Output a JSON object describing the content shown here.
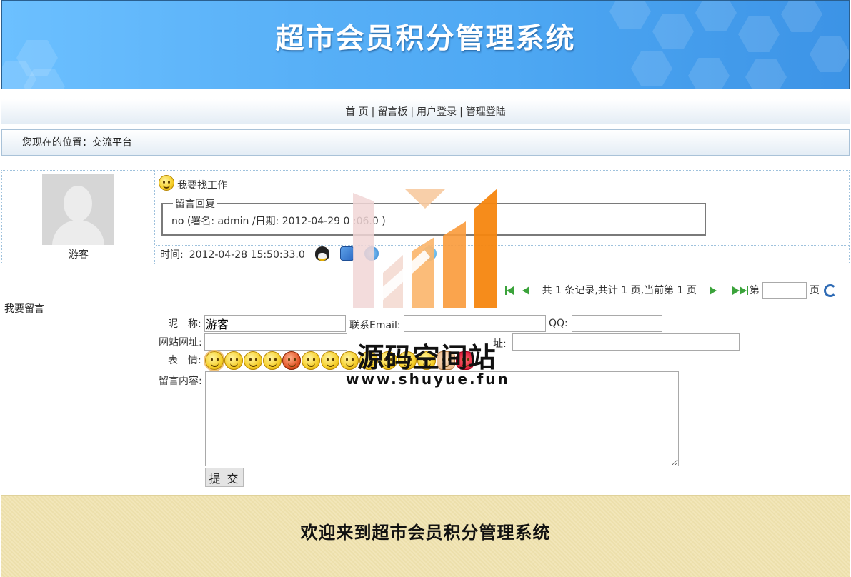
{
  "banner": {
    "title": "超市会员积分管理系统"
  },
  "nav": {
    "items": [
      "首 页",
      "留言板",
      "用户登录",
      "管理登陆"
    ],
    "separator": "|"
  },
  "location": {
    "text": "您现在的位置：交流平台"
  },
  "message": {
    "poster": "游客",
    "title": "我要找工作",
    "reply_legend": "留言回复",
    "reply_text": "no (署名: admin /日期: 2012-04-29 0 :06.0 )",
    "time_label": "时间:",
    "time_value": "2012-04-28 15:50:33.0",
    "icons": [
      "qq-icon",
      "mail-icon",
      "home-icon",
      "globe-icon"
    ]
  },
  "pager": {
    "summary": "共 1 条记录,共计 1 页,当前第 1 页",
    "goto_prefix": "第",
    "goto_suffix": "页",
    "page_input_value": ""
  },
  "form": {
    "heading": "我要留言",
    "nickname_label": "昵　称:",
    "nickname_value": "游客",
    "email_label": "联系Email:",
    "email_value": "",
    "qq_label": "QQ:",
    "qq_value": "",
    "website_label": "网站网址:",
    "website_value": "",
    "other_label": "址:",
    "other_value": "",
    "emotion_label": "表　情:",
    "content_label": "留言内容:",
    "content_value": "",
    "submit_label": "提 交"
  },
  "footer": {
    "title": "欢迎来到超市会员积分管理系统"
  },
  "watermark": {
    "text": "源码空间站",
    "url": "www.shuyue.fun"
  },
  "colors": {
    "banner_blue": "#4ea8f3",
    "nav_border": "#a9c2d8",
    "footer_bg": "#f2e6b9",
    "pager_green": "#3ba33b"
  }
}
